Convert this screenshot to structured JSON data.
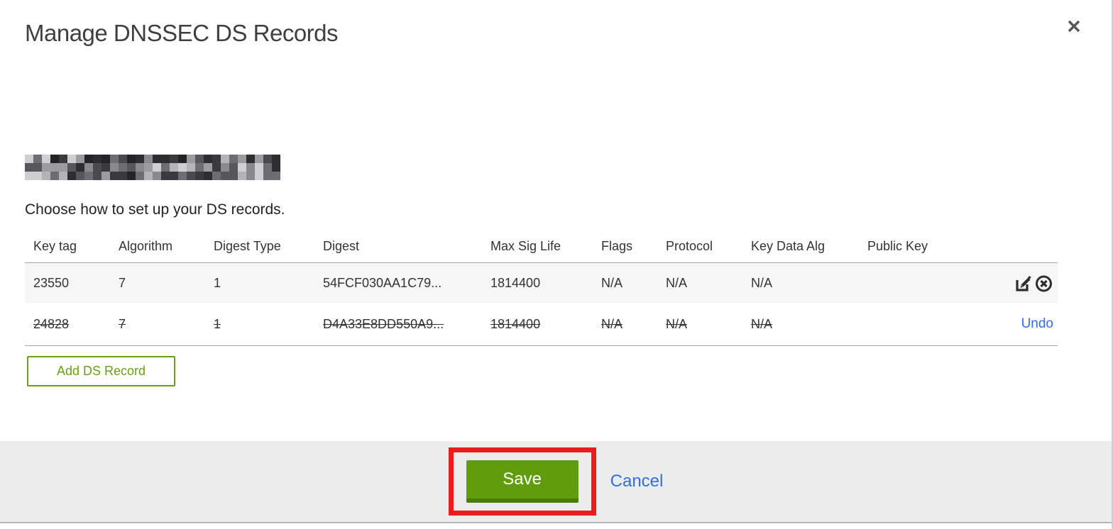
{
  "modal": {
    "title": "Manage DNSSEC DS Records",
    "subtitle": "Choose how to set up your DS records.",
    "redacted_domain": {
      "note": "domain name pixelated/redacted",
      "seed": 7,
      "palette": [
        "#2e2e30",
        "#4a4a4e",
        "#6e6e72",
        "#8a8a8e",
        "#b4b4b6",
        "#cfcfd1",
        "#3a3a3e",
        "#57575b",
        "#9c9c9e",
        "#242426"
      ]
    }
  },
  "table": {
    "columns": [
      "Key tag",
      "Algorithm",
      "Digest Type",
      "Digest",
      "Max Sig Life",
      "Flags",
      "Protocol",
      "Key Data Alg",
      "Public Key"
    ],
    "rows": [
      {
        "key_tag": "23550",
        "algorithm": "7",
        "digest_type": "1",
        "digest": "54FCF030AA1C79...",
        "max_sig_life": "1814400",
        "flags": "N/A",
        "protocol": "N/A",
        "key_data_alg": "N/A",
        "public_key": "",
        "state": "normal"
      },
      {
        "key_tag": "24828",
        "algorithm": "7",
        "digest_type": "1",
        "digest": "D4A33E8DD550A9...",
        "max_sig_life": "1814400",
        "flags": "N/A",
        "protocol": "N/A",
        "key_data_alg": "N/A",
        "public_key": "",
        "state": "deleted",
        "undo_label": "Undo"
      }
    ],
    "add_button_label": "Add DS Record"
  },
  "footer": {
    "save_label": "Save",
    "cancel_label": "Cancel"
  },
  "colors": {
    "brand_green": "#609c0c",
    "brand_green_dark": "#4c7d09",
    "outline_green": "#69a010",
    "link_blue": "#2e6fe6",
    "annotation_red": "#ed1b1b",
    "footer_gray": "#ececec"
  }
}
